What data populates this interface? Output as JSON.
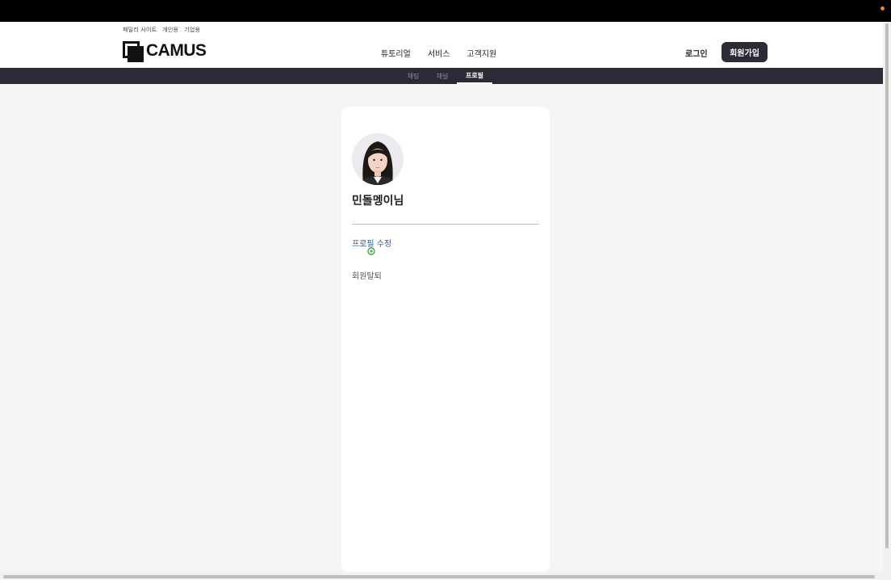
{
  "browser": {
    "indicator_color": "#e08a2c"
  },
  "header": {
    "family_links": [
      "패밀리 사이트",
      "개인용",
      "기업용"
    ],
    "logo_text": "CAMUS",
    "nav": [
      "튜토리얼",
      "서비스",
      "고객지원"
    ],
    "login": "로그인",
    "signup": "회원가입"
  },
  "subnav": {
    "tabs": [
      "채팅",
      "채널",
      "프로필"
    ],
    "active": "프로필"
  },
  "profile": {
    "name": "민돌멩이님",
    "edit_link": "프로필 수정",
    "withdraw": "회원탈퇴"
  },
  "colors": {
    "dark": "#2a2b35",
    "link": "#2a5f93",
    "background": "#f5f4f7"
  }
}
